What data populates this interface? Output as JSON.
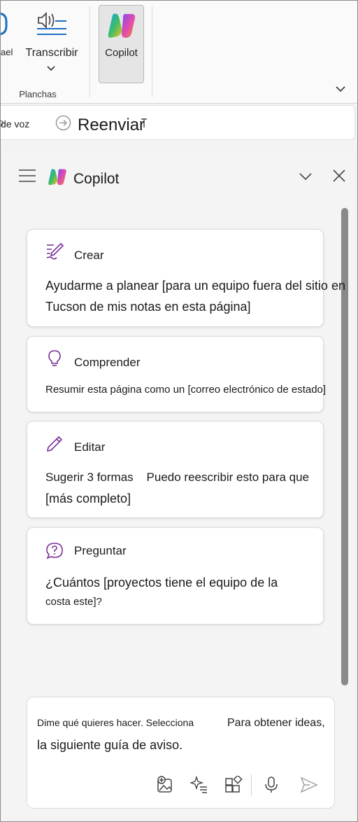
{
  "ribbon": {
    "partial_label": "ael",
    "transcribe_label": "Transcribir",
    "group_label": "Planchas",
    "copilot_label": "Copilot"
  },
  "strip": {
    "voice_label": "de voz",
    "forward_label": "Reenviar"
  },
  "pane": {
    "title": "Copilot",
    "cards": [
      {
        "icon": "compose-pen-icon",
        "title": "Crear",
        "body_line1": "Ayudarme a planear [para un equipo fuera del sitio en",
        "body_line2": "Tucson de mis notas en esta página]"
      },
      {
        "icon": "lightbulb-icon",
        "title": "Comprender",
        "body_line1": "Resumir esta página como un [correo electrónico de estado]"
      },
      {
        "icon": "pencil-icon",
        "title": "Editar",
        "body_line1": "Sugerir 3 formas    Puedo reescribir esto para que",
        "body_line2": "[más completo]"
      },
      {
        "icon": "question-bubble-icon",
        "title": "Preguntar",
        "body_line1": "¿Cuántos [proyectos tiene el equipo de la",
        "body_line2": "costa este]?"
      }
    ]
  },
  "input": {
    "placeholder_part1": "Dime qué quieres hacer. Selecciona",
    "placeholder_part2": "Para obtener ideas,",
    "placeholder_part3": "la siguiente guía de aviso."
  },
  "colors": {
    "accent_purple": "#7a2f98",
    "ribbon_blue": "#1f6fc4",
    "scrollbar": "#8a8a8a"
  }
}
